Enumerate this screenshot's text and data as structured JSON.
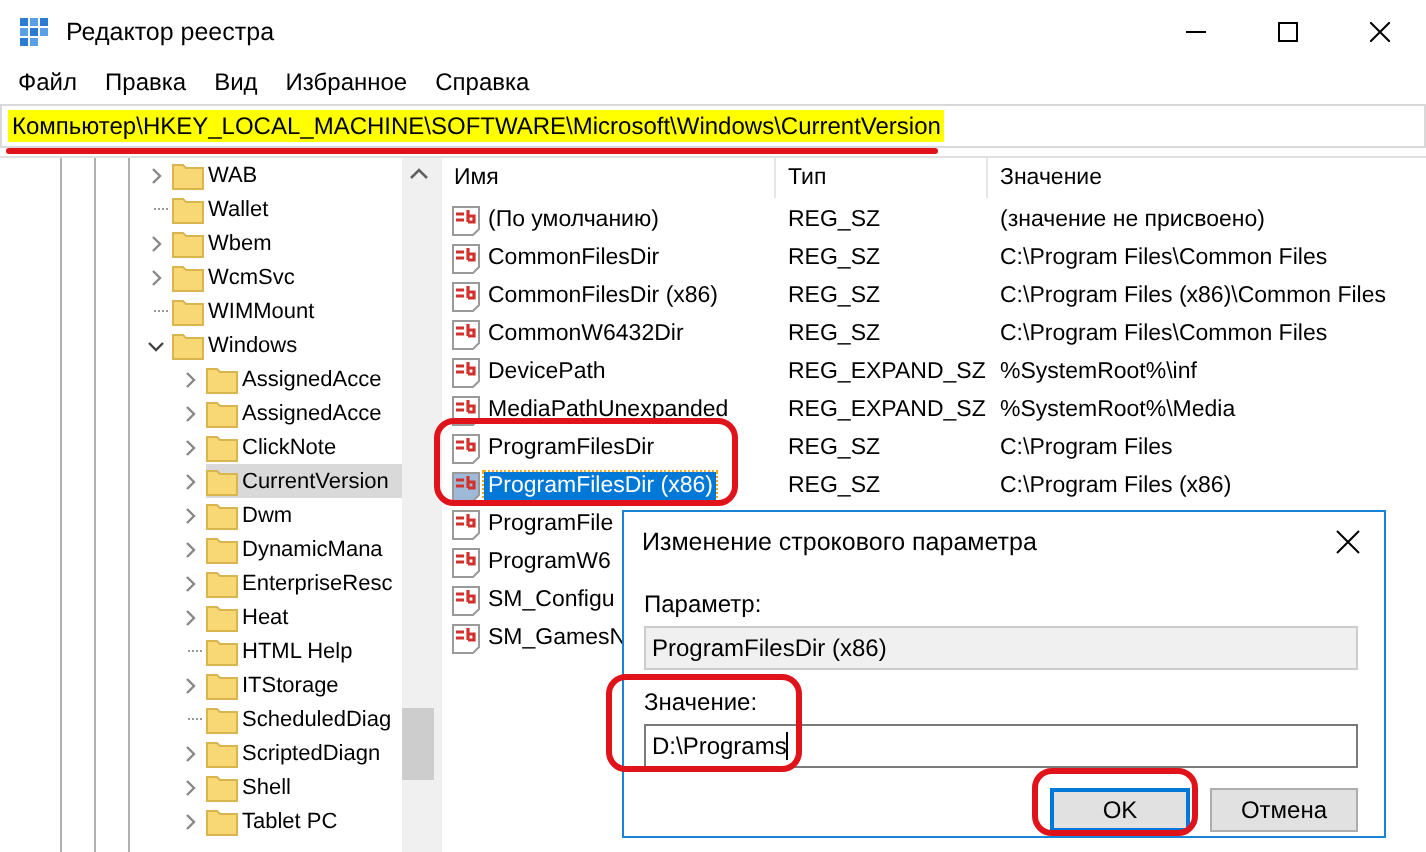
{
  "window": {
    "title": "Редактор реестра"
  },
  "menu": [
    "Файл",
    "Правка",
    "Вид",
    "Избранное",
    "Справка"
  ],
  "address": {
    "path": "Компьютер\\HKEY_LOCAL_MACHINE\\SOFTWARE\\Microsoft\\Windows\\CurrentVersion"
  },
  "tree": {
    "items": [
      {
        "label": "WAB",
        "expandable": true,
        "expanded": false,
        "selected": false
      },
      {
        "label": "Wallet",
        "expandable": false,
        "selected": false
      },
      {
        "label": "Wbem",
        "expandable": true,
        "expanded": false,
        "selected": false
      },
      {
        "label": "WcmSvc",
        "expandable": true,
        "expanded": false,
        "selected": false
      },
      {
        "label": "WIMMount",
        "expandable": false,
        "selected": false
      },
      {
        "label": "Windows",
        "expandable": true,
        "expanded": true,
        "selected": false,
        "children": [
          {
            "label": "AssignedAcce",
            "expandable": true,
            "expanded": false,
            "selected": false
          },
          {
            "label": "AssignedAcce",
            "expandable": true,
            "expanded": false,
            "selected": false
          },
          {
            "label": "ClickNote",
            "expandable": true,
            "expanded": false,
            "selected": false
          },
          {
            "label": "CurrentVersion",
            "expandable": true,
            "expanded": false,
            "selected": true
          },
          {
            "label": "Dwm",
            "expandable": true,
            "expanded": false,
            "selected": false
          },
          {
            "label": "DynamicMana",
            "expandable": true,
            "expanded": false,
            "selected": false
          },
          {
            "label": "EnterpriseResc",
            "expandable": true,
            "expanded": false,
            "selected": false
          },
          {
            "label": "Heat",
            "expandable": true,
            "expanded": false,
            "selected": false
          },
          {
            "label": "HTML Help",
            "expandable": false,
            "selected": false
          },
          {
            "label": "ITStorage",
            "expandable": true,
            "expanded": false,
            "selected": false
          },
          {
            "label": "ScheduledDiag",
            "expandable": false,
            "selected": false
          },
          {
            "label": "ScriptedDiagn",
            "expandable": true,
            "expanded": false,
            "selected": false
          },
          {
            "label": "Shell",
            "expandable": true,
            "expanded": false,
            "selected": false
          },
          {
            "label": "Tablet PC",
            "expandable": true,
            "expanded": false,
            "selected": false
          }
        ]
      }
    ]
  },
  "table": {
    "columns": [
      "Имя",
      "Тип",
      "Значение"
    ],
    "rows": [
      {
        "name": "(По умолчанию)",
        "type": "REG_SZ",
        "value": "(значение не присвоено)",
        "selected": false
      },
      {
        "name": "CommonFilesDir",
        "type": "REG_SZ",
        "value": "C:\\Program Files\\Common Files",
        "selected": false
      },
      {
        "name": "CommonFilesDir (x86)",
        "type": "REG_SZ",
        "value": "C:\\Program Files (x86)\\Common Files",
        "selected": false
      },
      {
        "name": "CommonW6432Dir",
        "type": "REG_SZ",
        "value": "C:\\Program Files\\Common Files",
        "selected": false
      },
      {
        "name": "DevicePath",
        "type": "REG_EXPAND_SZ",
        "value": "%SystemRoot%\\inf",
        "selected": false
      },
      {
        "name": "MediaPathUnexpanded",
        "type": "REG_EXPAND_SZ",
        "value": "%SystemRoot%\\Media",
        "selected": false
      },
      {
        "name": "ProgramFilesDir",
        "type": "REG_SZ",
        "value": "C:\\Program Files",
        "selected": false
      },
      {
        "name": "ProgramFilesDir (x86)",
        "type": "REG_SZ",
        "value": "C:\\Program Files (x86)",
        "selected": true
      },
      {
        "name": "ProgramFile",
        "selected": false
      },
      {
        "name": "ProgramW6",
        "selected": false
      },
      {
        "name": "SM_Configu",
        "selected": false
      },
      {
        "name": "SM_GamesN",
        "selected": false
      }
    ]
  },
  "dialog": {
    "title": "Изменение строкового параметра",
    "name_label": "Параметр:",
    "name_value": "ProgramFilesDir (x86)",
    "value_label": "Значение:",
    "value": "D:\\Programs",
    "buttons": [
      {
        "label": "OK",
        "default": true
      },
      {
        "label": "Отмена",
        "default": false
      }
    ]
  }
}
